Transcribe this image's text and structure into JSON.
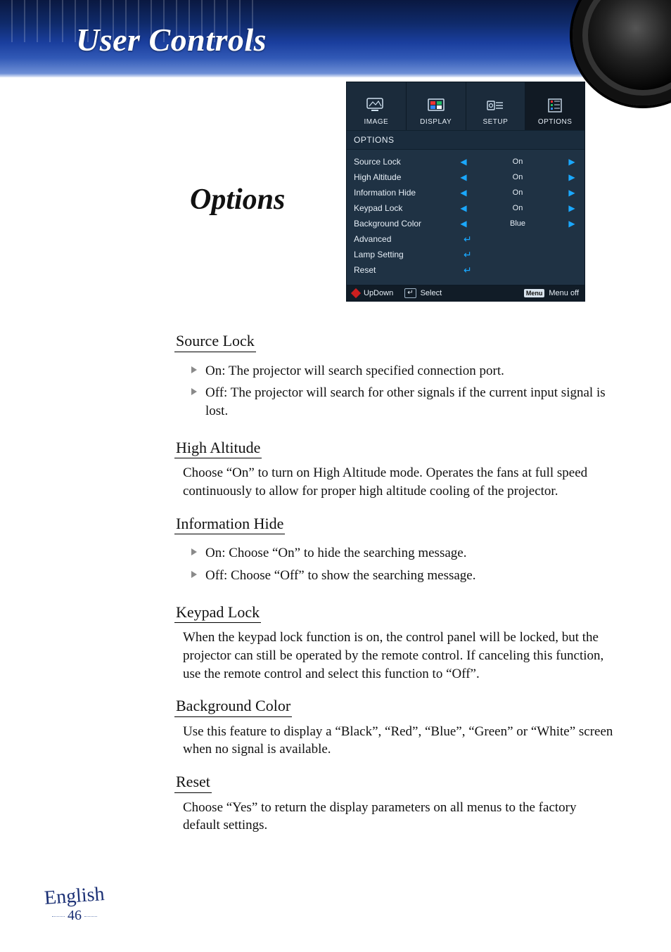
{
  "header": {
    "title": "User Controls"
  },
  "section_title": "Options",
  "osd": {
    "tabs": [
      {
        "label": "IMAGE"
      },
      {
        "label": "DISPLAY"
      },
      {
        "label": "SETUP"
      },
      {
        "label": "OPTIONS"
      }
    ],
    "subhead": "OPTIONS",
    "rows": [
      {
        "label": "Source Lock",
        "value": "On",
        "type": "lr"
      },
      {
        "label": "High Altitude",
        "value": "On",
        "type": "lr"
      },
      {
        "label": "Information Hide",
        "value": "On",
        "type": "lr"
      },
      {
        "label": "Keypad Lock",
        "value": "On",
        "type": "lr"
      },
      {
        "label": "Background Color",
        "value": "Blue",
        "type": "lr"
      },
      {
        "label": "Advanced",
        "value": "",
        "type": "enter"
      },
      {
        "label": "Lamp Setting",
        "value": "",
        "type": "enter"
      },
      {
        "label": "Reset",
        "value": "",
        "type": "enter"
      }
    ],
    "footer": {
      "updown": "UpDown",
      "select": "Select",
      "menu_key": "Menu",
      "menu_off": "Menu off",
      "enter_glyph": "↵"
    }
  },
  "body": {
    "source_lock": {
      "title": "Source Lock",
      "on": "On: The projector will search specified connection port.",
      "off": "Off: The projector will search for other signals if the current input signal is lost."
    },
    "high_altitude": {
      "title": "High Altitude",
      "text": "Choose “On” to turn on High Altitude mode. Operates the fans at full speed continuously to allow for proper high altitude cooling of the projector."
    },
    "info_hide": {
      "title": "Information Hide",
      "on": "On: Choose “On” to hide the searching message.",
      "off": "Off: Choose “Off” to show the searching message."
    },
    "keypad_lock": {
      "title": "Keypad Lock",
      "text": "When the keypad lock function is on, the control panel will be locked, but the projector can still be operated by the remote control. If canceling this function, use the remote control and select this func­tion to “Off”."
    },
    "bg_color": {
      "title": "Background Color",
      "text": "Use this feature to display a “Black”, “Red”, “Blue”, “Green” or “White” screen when no signal is available."
    },
    "reset": {
      "title": "Reset",
      "text": "Choose “Yes” to return the display parameters on all menus to the factory default settings."
    }
  },
  "footer": {
    "language": "English",
    "page": "46"
  }
}
